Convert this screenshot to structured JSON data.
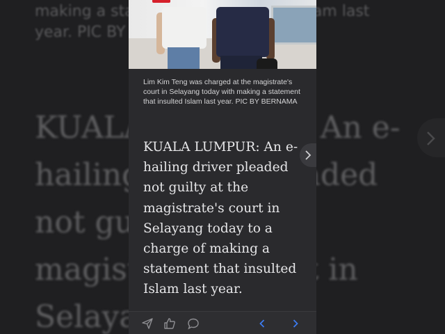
{
  "background": {
    "top_lines": [
      "making a statement that insulted Islam last",
      "year. PIC BY BERNAMA"
    ],
    "body_lines": [
      "KUALA LUMPUR: An e-",
      "hailing driver pleaded",
      "not guilty at the",
      "magistrate's court in",
      "Selayang"
    ]
  },
  "article": {
    "caption": "Lim Kim Teng was charged at the magistrate's court in Selayang today with making a statement that insulted Islam last year. PIC BY BERNAMA",
    "body": "KUALA LUMPUR: An e-hailing driver pleaded not guilty at the magistrate's court in Selayang today to a charge of making a statement that insulted Islam last year."
  },
  "toolbar": {
    "icons": [
      "share-icon",
      "like-icon",
      "comment-icon",
      "prev-icon",
      "next-icon"
    ]
  },
  "colors": {
    "background": "#1e1e20",
    "panel": "#2a2a2d",
    "accent": "#3d7bf0"
  }
}
